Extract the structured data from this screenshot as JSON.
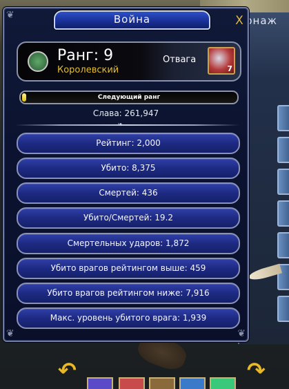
{
  "background": {
    "panel_title": "рнаж"
  },
  "window": {
    "title": "Война",
    "close_label": "X"
  },
  "rank": {
    "label": "Ранг: 9",
    "title": "Королевский"
  },
  "valor": {
    "label": "Отвага",
    "count": "7"
  },
  "next_rank": {
    "label": "Следующий ранг",
    "progress": 0.02
  },
  "glory": "Слава: 261,947",
  "stats": [
    "Рейтинг: 2,000",
    "Убито: 8,375",
    "Смертей: 436",
    "Убито/Смертей: 19.2",
    "Смертельных ударов: 1,872",
    "Убито врагов рейтингом выше: 459",
    "Убито врагов рейтингом ниже: 7,916",
    "Макс. уровень убитого врага: 1,939"
  ]
}
